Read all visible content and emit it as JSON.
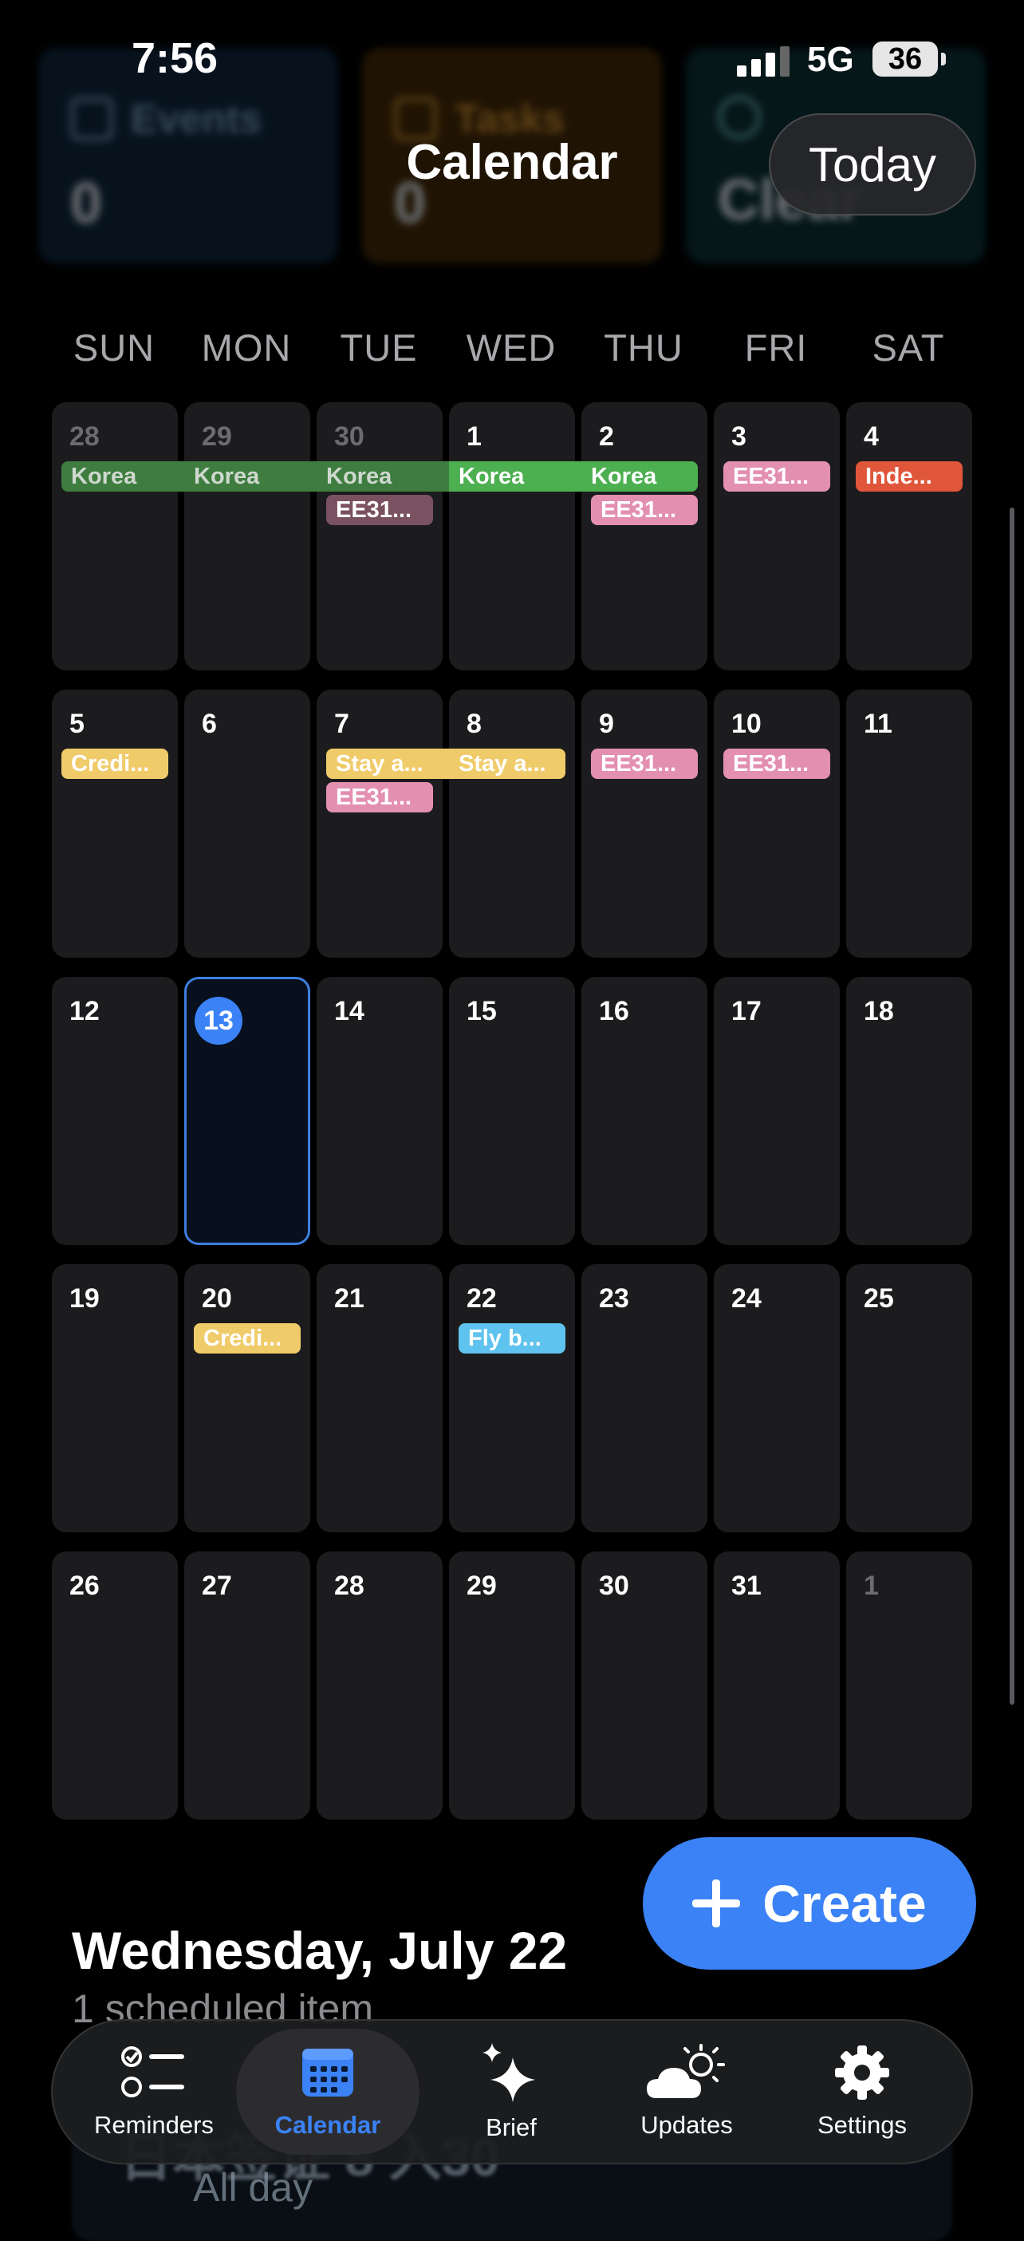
{
  "status_bar": {
    "time": "7:56",
    "network": "5G",
    "battery": "36"
  },
  "summary_cards": [
    {
      "label": "Events",
      "value": "0",
      "icon": "calendar-icon"
    },
    {
      "label": "Tasks",
      "value": "0",
      "icon": "list-icon"
    },
    {
      "label": "Clear",
      "value": "Clear",
      "icon": "clock-icon"
    }
  ],
  "header": {
    "title": "Calendar",
    "today_label": "Today"
  },
  "weekdays": [
    "SUN",
    "MON",
    "TUE",
    "WED",
    "THU",
    "FRI",
    "SAT"
  ],
  "colors": {
    "green": "#3e7d3f",
    "green_bright": "#4caf50",
    "pink": "#e38fb0",
    "pink_muted": "#7a5160",
    "red": "#e0563a",
    "yellow": "#f0cb6a",
    "blue": "#5ec3ee",
    "accent": "#3b82f6"
  },
  "calendar": {
    "today": "13",
    "weeks": [
      [
        {
          "d": "28",
          "other": true
        },
        {
          "d": "29",
          "other": true
        },
        {
          "d": "30",
          "other": true
        },
        {
          "d": "1"
        },
        {
          "d": "2"
        },
        {
          "d": "3"
        },
        {
          "d": "4"
        }
      ],
      [
        {
          "d": "5"
        },
        {
          "d": "6"
        },
        {
          "d": "7"
        },
        {
          "d": "8"
        },
        {
          "d": "9"
        },
        {
          "d": "10"
        },
        {
          "d": "11"
        }
      ],
      [
        {
          "d": "12"
        },
        {
          "d": "13",
          "today": true
        },
        {
          "d": "14"
        },
        {
          "d": "15"
        },
        {
          "d": "16"
        },
        {
          "d": "17"
        },
        {
          "d": "18"
        }
      ],
      [
        {
          "d": "19"
        },
        {
          "d": "20"
        },
        {
          "d": "21"
        },
        {
          "d": "22"
        },
        {
          "d": "23"
        },
        {
          "d": "24"
        },
        {
          "d": "25"
        }
      ],
      [
        {
          "d": "26"
        },
        {
          "d": "27"
        },
        {
          "d": "28"
        },
        {
          "d": "29"
        },
        {
          "d": "30"
        },
        {
          "d": "31"
        },
        {
          "d": "1",
          "other": true
        }
      ]
    ],
    "events": [
      {
        "label": "Korea",
        "week": 0,
        "col": 0,
        "slot": 0,
        "color": "green",
        "dim": true,
        "bar": true
      },
      {
        "label": "Korea",
        "week": 0,
        "col": 1,
        "slot": 0,
        "color": "green",
        "dim": true,
        "bar": true
      },
      {
        "label": "Korea",
        "week": 0,
        "col": 2,
        "slot": 0,
        "color": "green",
        "dim": true,
        "bar": true
      },
      {
        "label": "Korea",
        "week": 0,
        "col": 3,
        "slot": 0,
        "color": "green_bright",
        "bar": true
      },
      {
        "label": "Korea",
        "week": 0,
        "col": 4,
        "slot": 0,
        "color": "green_bright",
        "bar": true,
        "end": true
      },
      {
        "label": "EE31...",
        "week": 0,
        "col": 2,
        "slot": 1,
        "color": "pink_muted"
      },
      {
        "label": "EE31...",
        "week": 0,
        "col": 4,
        "slot": 1,
        "color": "pink"
      },
      {
        "label": "EE31...",
        "week": 0,
        "col": 5,
        "slot": 0,
        "color": "pink"
      },
      {
        "label": "Inde...",
        "week": 0,
        "col": 6,
        "slot": 0,
        "color": "red"
      },
      {
        "label": "Credi...",
        "week": 1,
        "col": 0,
        "slot": 0,
        "color": "yellow"
      },
      {
        "label": "Stay a...",
        "week": 1,
        "col": 2,
        "slot": 0,
        "color": "yellow",
        "bar": true
      },
      {
        "label": "EE31...",
        "week": 1,
        "col": 2,
        "slot": 1,
        "color": "pink"
      },
      {
        "label": "Stay a...",
        "week": 1,
        "col": 3,
        "slot": 0,
        "color": "yellow",
        "bar": true,
        "end": true
      },
      {
        "label": "EE31...",
        "week": 1,
        "col": 4,
        "slot": 0,
        "color": "pink"
      },
      {
        "label": "EE31...",
        "week": 1,
        "col": 5,
        "slot": 0,
        "color": "pink"
      },
      {
        "label": "Credi...",
        "week": 3,
        "col": 1,
        "slot": 0,
        "color": "yellow"
      },
      {
        "label": "Fly b...",
        "week": 3,
        "col": 3,
        "slot": 0,
        "color": "blue"
      }
    ]
  },
  "create_label": "Create",
  "selected_day": {
    "date": "Wednesday, July 22",
    "count": "1 scheduled item",
    "event_title": "日本签证 8 入30",
    "event_time": "All day"
  },
  "tabs": [
    {
      "label": "Reminders",
      "icon": "reminders-list-icon",
      "active": false
    },
    {
      "label": "Calendar",
      "icon": "calendar-grid-icon",
      "active": true
    },
    {
      "label": "Brief",
      "icon": "sparkles-icon",
      "active": false
    },
    {
      "label": "Updates",
      "icon": "cloud-sun-icon",
      "active": false
    },
    {
      "label": "Settings",
      "icon": "gear-icon",
      "active": false
    }
  ]
}
